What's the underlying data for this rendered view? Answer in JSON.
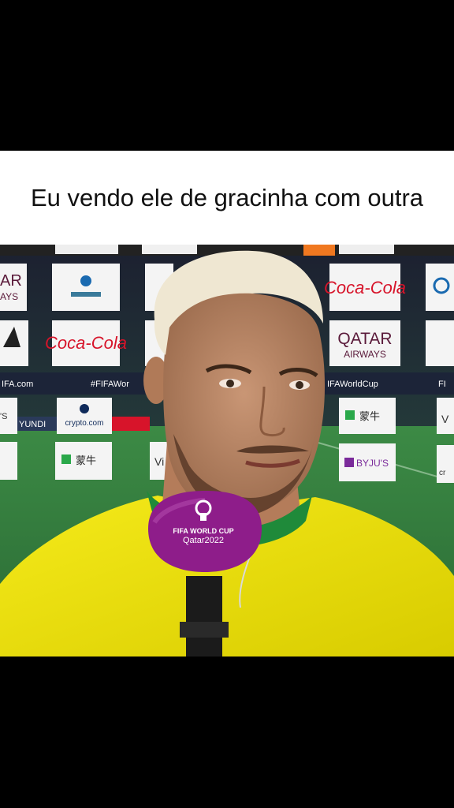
{
  "caption": {
    "text": "Eu vendo ele de gracinha com outra"
  },
  "video": {
    "scene": "post-match interview",
    "mic_flag_lines": [
      "FIFA WORLD CUP",
      "Qatar2022"
    ],
    "boards": {
      "coca_cola": "Coca-Cola",
      "qatar_line1": "QATAR",
      "qatar_line2": "AIRWAYS",
      "qatar_partial_line1": "AR",
      "qatar_partial_line2": "AYS",
      "fifa_com": "IFA.com",
      "hashtag": "#FIFAWor",
      "hashtag_right": "IFAWorldCup",
      "hashtag_right_partial": "FI",
      "crypto": "crypto.com",
      "yundai": "YUNDI",
      "mengniu": "蒙牛",
      "byjus": "BYJU'S",
      "vi": "Vi",
      "cr": "cr",
      "us": "'S",
      "v": "V"
    },
    "colors": {
      "jersey": "#f2e600",
      "mic": "#8e1d8a",
      "pitch": "#2f7a3a"
    }
  }
}
